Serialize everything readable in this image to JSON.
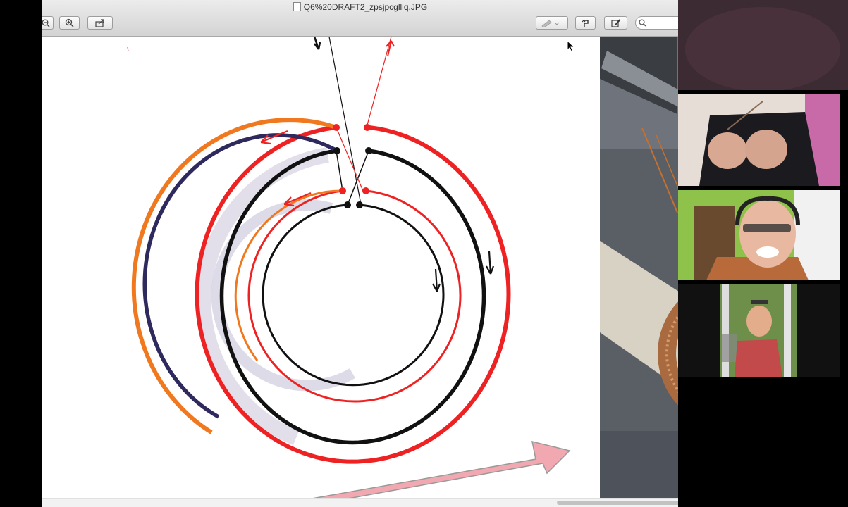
{
  "window": {
    "title": "Q6%20DRAFT2_zpsjpcglliq.JPG"
  },
  "toolbar": {
    "buttons": [
      {
        "name": "zoom-out",
        "icon": "zoom-out-icon"
      },
      {
        "name": "zoom-in",
        "icon": "zoom-in-icon"
      },
      {
        "name": "share",
        "icon": "share-icon"
      },
      {
        "name": "markup-pen",
        "icon": "pen-icon"
      },
      {
        "name": "rotate",
        "icon": "rotate-icon"
      },
      {
        "name": "edit-toolbar",
        "icon": "edit-pencil-icon"
      }
    ],
    "search_placeholder": ""
  },
  "diagram": {
    "colors": {
      "red": "#ee2222",
      "black": "#111111",
      "orange": "#f0781e",
      "navy": "#2e2a5e",
      "shadow": "#d6d2e2",
      "pink_arrow": "#f1a8b0"
    }
  },
  "video_call": {
    "participants": 4
  }
}
